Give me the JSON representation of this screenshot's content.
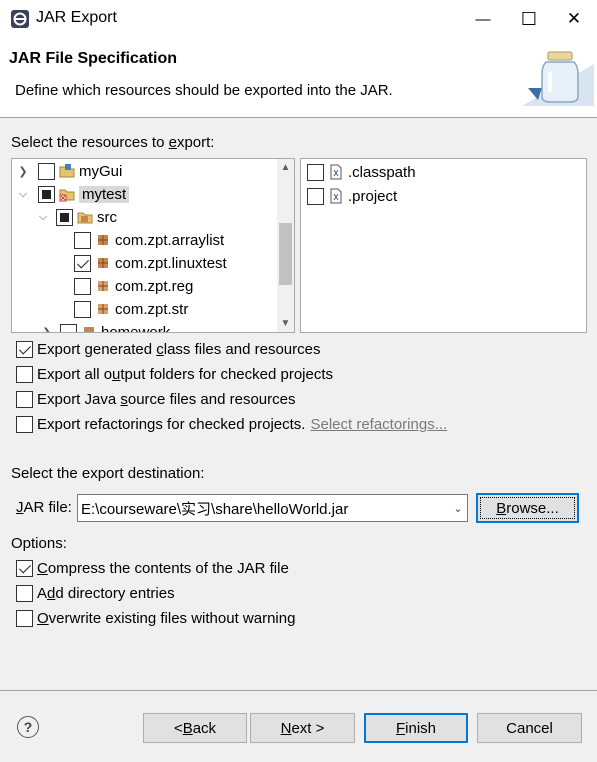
{
  "window": {
    "title": "JAR Export",
    "minimize_glyph": "—",
    "maximize_glyph": "☐",
    "close_glyph": "✕"
  },
  "banner": {
    "title": "JAR File Specification",
    "description": "Define which resources should be exported into the JAR."
  },
  "resources": {
    "label_before": "Select the resources to ",
    "label_accel": "e",
    "label_after": "xport:",
    "tree": [
      {
        "label": "myGui",
        "state": "unchecked",
        "expanded": false,
        "icon": "project-icon"
      },
      {
        "label": "mytest",
        "state": "partial",
        "expanded": true,
        "icon": "project-error-icon",
        "selected": true
      },
      {
        "label": "src",
        "state": "partial",
        "expanded": true,
        "icon": "source-folder-icon"
      },
      {
        "label": "com.zpt.arraylist",
        "state": "unchecked",
        "icon": "package-icon"
      },
      {
        "label": "com.zpt.linuxtest",
        "state": "checked",
        "icon": "package-icon"
      },
      {
        "label": "com.zpt.reg",
        "state": "unchecked",
        "icon": "package-icon"
      },
      {
        "label": "com.zpt.str",
        "state": "unchecked",
        "icon": "package-icon"
      },
      {
        "label": "homework",
        "state": "unchecked",
        "icon": "package-icon"
      }
    ],
    "files": [
      {
        "label": ".classpath",
        "state": "unchecked",
        "icon": "file-icon"
      },
      {
        "label": ".project",
        "state": "unchecked",
        "icon": "file-icon"
      }
    ]
  },
  "options_top": [
    {
      "before": "Export generated ",
      "accel": "c",
      "after": "lass files and resources",
      "checked": true
    },
    {
      "before": "Export all o",
      "accel": "u",
      "after": "tput folders for checked projects",
      "checked": false
    },
    {
      "before": "Export Java ",
      "accel": "s",
      "after": "ource files and resources",
      "checked": false
    },
    {
      "before": "Export refactorings for checked projects.",
      "accel": "",
      "after": "",
      "checked": false,
      "link": "Select refactorings..."
    }
  ],
  "destination": {
    "label": "Select the export destination:",
    "jar_label_accel": "J",
    "jar_label_rest": "AR file:",
    "jar_value": "E:\\courseware\\实习\\share\\helloWorld.jar",
    "browse_accel": "B",
    "browse_rest": "rowse..."
  },
  "options": {
    "label": "Options:",
    "items": [
      {
        "before": "",
        "accel": "C",
        "after": "ompress the contents of the JAR file",
        "checked": true
      },
      {
        "before": "A",
        "accel": "d",
        "after": "d directory entries",
        "checked": false
      },
      {
        "before": "",
        "accel": "O",
        "after": "verwrite existing files without warning",
        "checked": false
      }
    ]
  },
  "footer": {
    "help_glyph": "?",
    "back_prefix": "< ",
    "back_accel": "B",
    "back_rest": "ack",
    "next_accel": "N",
    "next_rest": "ext >",
    "finish_accel": "F",
    "finish_rest": "inish",
    "cancel": "Cancel"
  }
}
